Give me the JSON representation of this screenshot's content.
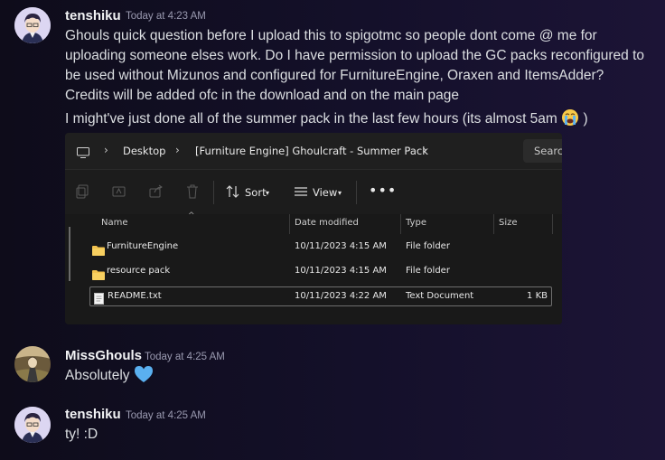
{
  "messages": [
    {
      "username": "tenshiku",
      "timestamp": "Today at 4:23 AM",
      "lines": [
        "Ghouls quick question before I upload this to spigotmc so people dont come @ me for",
        "uploading someone elses work. Do I have permission to upload the GC packs reconfigured to",
        "be used without Mizunos and configured for FurnitureEngine, Oraxen and ItemsAdder?",
        "Credits will be added ofc in the download and on the main page"
      ],
      "line2_before_emoji": "I might've just done all of the summer pack in the last few hours (its almost 5am",
      "line2_after_emoji": ")",
      "emoji": "loudly-crying-face"
    },
    {
      "username": "MissGhouls",
      "timestamp": "Today at 4:25 AM",
      "text": "Absolutely",
      "emoji": "blue-heart"
    },
    {
      "username": "tenshiku",
      "timestamp": "Today at 4:25 AM",
      "text": "ty! :D"
    }
  ],
  "explorer": {
    "breadcrumbs": [
      "Desktop",
      "[Furniture Engine] Ghoulcraft - Summer Pack"
    ],
    "search_placeholder": "Search",
    "toolbar": {
      "sort_label": "Sort",
      "view_label": "View"
    },
    "columns": [
      "Name",
      "Date modified",
      "Type",
      "Size"
    ],
    "files": [
      {
        "name": "FurnitureEngine",
        "date": "10/11/2023 4:15 AM",
        "type": "File folder",
        "size": "",
        "kind": "folder"
      },
      {
        "name": "resource pack",
        "date": "10/11/2023 4:15 AM",
        "type": "File folder",
        "size": "",
        "kind": "folder"
      },
      {
        "name": "README.txt",
        "date": "10/11/2023 4:22 AM",
        "type": "Text Document",
        "size": "1 KB",
        "kind": "text"
      }
    ]
  },
  "colors": {
    "background": "#14102a",
    "folder": "#f2c14e",
    "heart": "#5ab0f0"
  }
}
